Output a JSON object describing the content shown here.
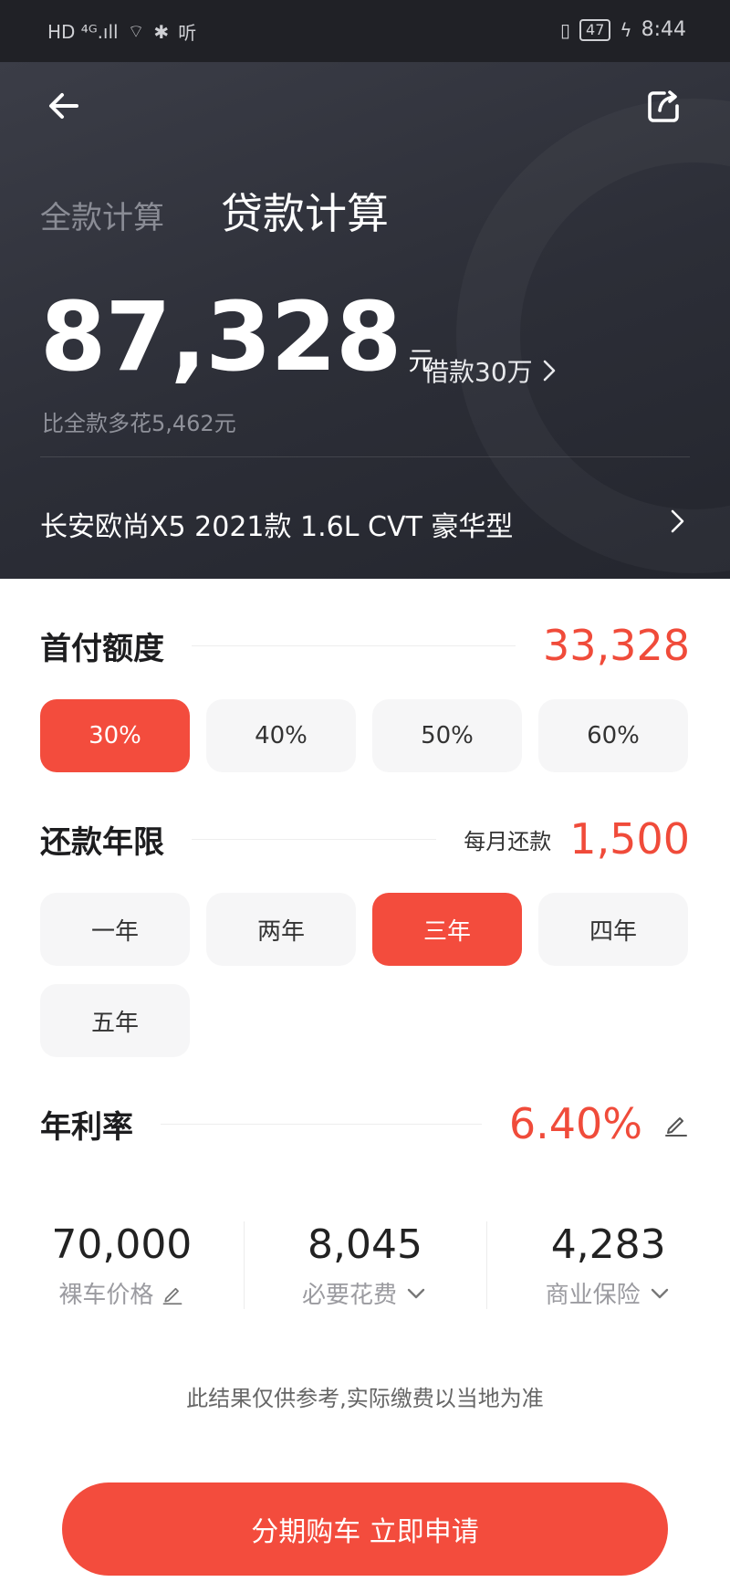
{
  "status_bar": {
    "left_network": "HD ⁴ᴳ.ıll",
    "wifi_glyph": "⌔",
    "bluetooth_glyph": "✱",
    "audio_text": "听",
    "vibrate_glyph": "▯",
    "battery": "47",
    "charging_glyph": "ϟ",
    "time": "8:44"
  },
  "header": {
    "tabs": [
      {
        "label": "全款计算",
        "active": false
      },
      {
        "label": "贷款计算",
        "active": true
      }
    ],
    "total_amount": "87,328",
    "unit": "元",
    "loan_label": "借款30万",
    "diff_text": "比全款多花5,462元",
    "car_model": "长安欧尚X5 2021款 1.6L CVT 豪华型"
  },
  "down_payment": {
    "title": "首付额度",
    "value": "33,328",
    "options": [
      {
        "label": "30%",
        "active": true
      },
      {
        "label": "40%",
        "active": false
      },
      {
        "label": "50%",
        "active": false
      },
      {
        "label": "60%",
        "active": false
      }
    ]
  },
  "term": {
    "title": "还款年限",
    "monthly_label": "每月还款",
    "monthly_value": "1,500",
    "options": [
      {
        "label": "一年",
        "active": false
      },
      {
        "label": "两年",
        "active": false
      },
      {
        "label": "三年",
        "active": true
      },
      {
        "label": "四年",
        "active": false
      },
      {
        "label": "五年",
        "active": false
      }
    ]
  },
  "rate": {
    "title": "年利率",
    "value": "6.40%"
  },
  "costs": [
    {
      "value": "70,000",
      "label": "裸车价格",
      "icon": "pencil-icon"
    },
    {
      "value": "8,045",
      "label": "必要花费",
      "icon": "chevron-down-icon"
    },
    {
      "value": "4,283",
      "label": "商业保险",
      "icon": "chevron-down-icon"
    }
  ],
  "disclaimer": "此结果仅供参考,实际缴费以当地为准",
  "cta": "分期购车 立即申请",
  "colors": {
    "accent": "#f34c3d",
    "header_bg": "#2f313a",
    "chip_bg": "#f6f6f7"
  }
}
